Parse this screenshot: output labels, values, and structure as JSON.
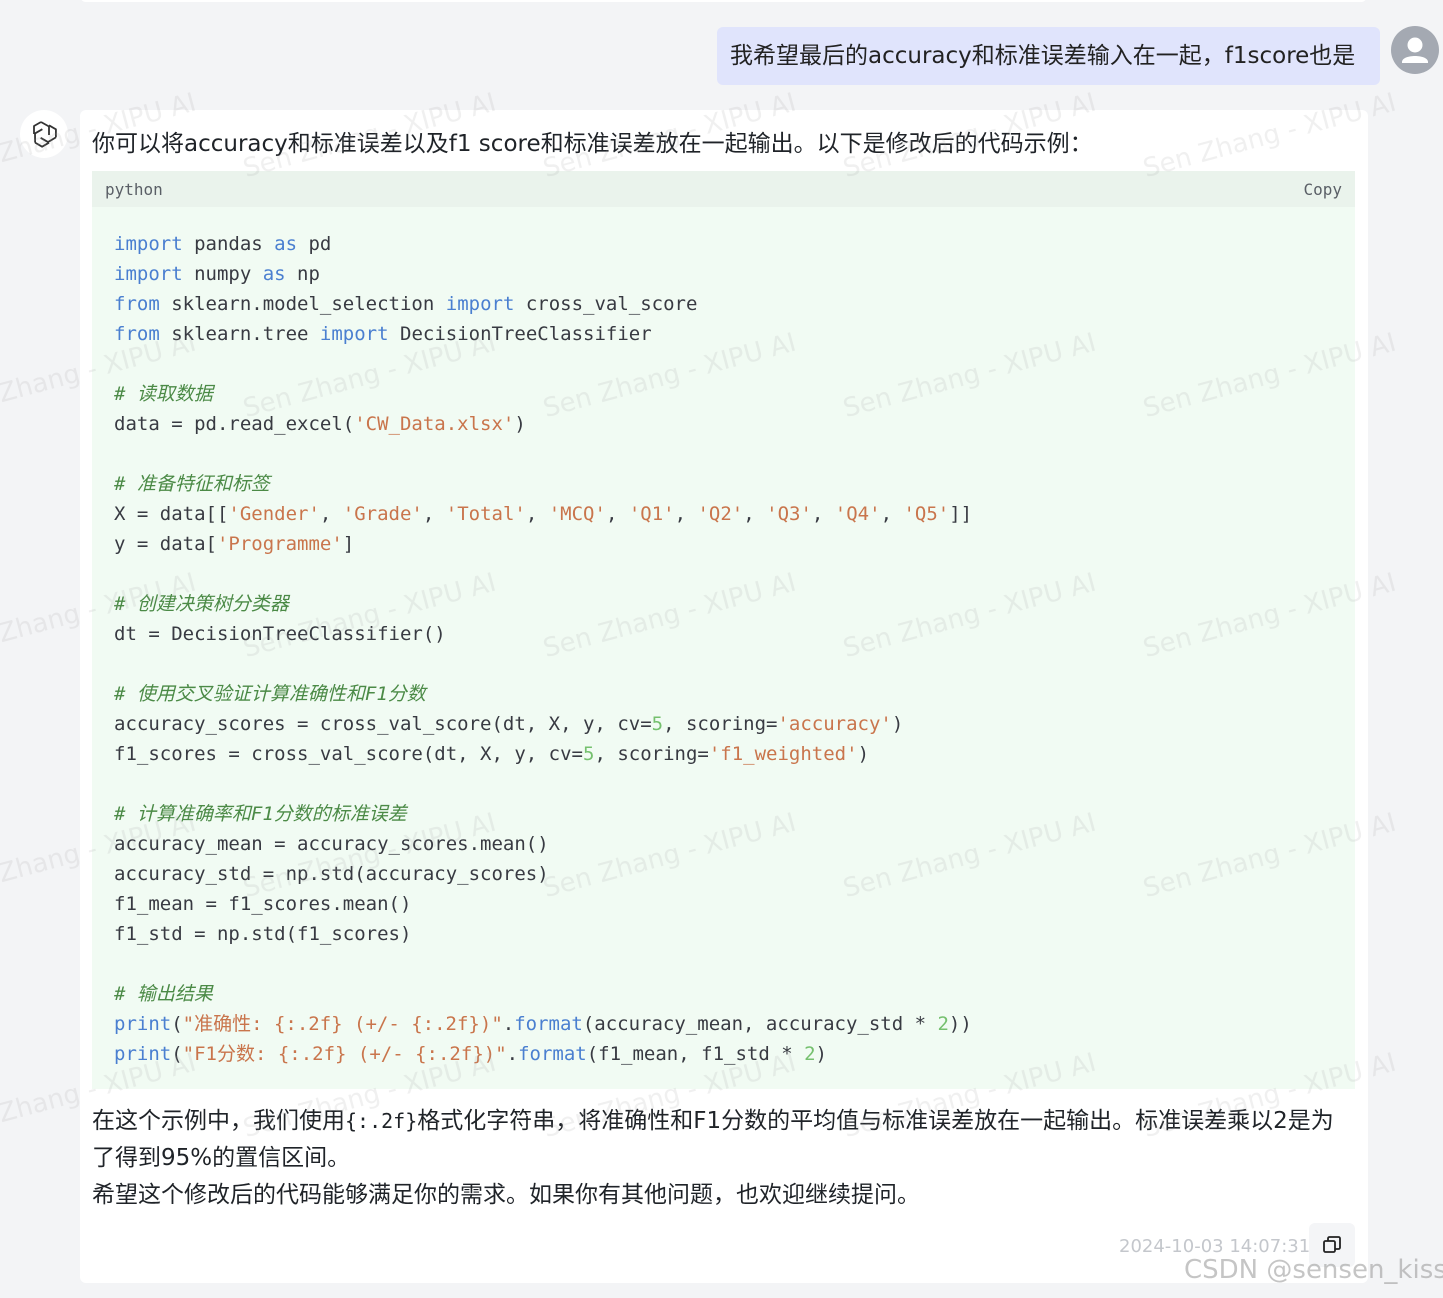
{
  "user_message": {
    "text": "我希望最后的accuracy和标准误差输入在一起，f1score也是",
    "avatar_icon": "user-avatar-icon"
  },
  "assistant_message": {
    "avatar_icon": "openai-logo-icon",
    "intro": "你可以将accuracy和标准误差以及f1 score和标准误差放在一起输出。以下是修改后的代码示例：",
    "code_block": {
      "language": "python",
      "copy_label": "Copy",
      "lines": [
        [
          {
            "t": "import",
            "c": "kw"
          },
          {
            "t": " pandas "
          },
          {
            "t": "as",
            "c": "kw"
          },
          {
            "t": " pd"
          }
        ],
        [
          {
            "t": "import",
            "c": "kw"
          },
          {
            "t": " numpy "
          },
          {
            "t": "as",
            "c": "kw"
          },
          {
            "t": " np"
          }
        ],
        [
          {
            "t": "from",
            "c": "kw"
          },
          {
            "t": " sklearn.model_selection "
          },
          {
            "t": "import",
            "c": "kw"
          },
          {
            "t": " cross_val_score"
          }
        ],
        [
          {
            "t": "from",
            "c": "kw"
          },
          {
            "t": " sklearn.tree "
          },
          {
            "t": "import",
            "c": "kw"
          },
          {
            "t": " DecisionTreeClassifier"
          }
        ],
        [],
        [
          {
            "t": "# 读取数据",
            "c": "cm"
          }
        ],
        [
          {
            "t": "data = pd.read_excel("
          },
          {
            "t": "'CW_Data.xlsx'",
            "c": "str"
          },
          {
            "t": ")"
          }
        ],
        [],
        [
          {
            "t": "# 准备特征和标签",
            "c": "cm"
          }
        ],
        [
          {
            "t": "X = data[["
          },
          {
            "t": "'Gender'",
            "c": "str"
          },
          {
            "t": ", "
          },
          {
            "t": "'Grade'",
            "c": "str"
          },
          {
            "t": ", "
          },
          {
            "t": "'Total'",
            "c": "str"
          },
          {
            "t": ", "
          },
          {
            "t": "'MCQ'",
            "c": "str"
          },
          {
            "t": ", "
          },
          {
            "t": "'Q1'",
            "c": "str"
          },
          {
            "t": ", "
          },
          {
            "t": "'Q2'",
            "c": "str"
          },
          {
            "t": ", "
          },
          {
            "t": "'Q3'",
            "c": "str"
          },
          {
            "t": ", "
          },
          {
            "t": "'Q4'",
            "c": "str"
          },
          {
            "t": ", "
          },
          {
            "t": "'Q5'",
            "c": "str"
          },
          {
            "t": "]]"
          }
        ],
        [
          {
            "t": "y = data["
          },
          {
            "t": "'Programme'",
            "c": "str"
          },
          {
            "t": "]"
          }
        ],
        [],
        [
          {
            "t": "# 创建决策树分类器",
            "c": "cm"
          }
        ],
        [
          {
            "t": "dt = DecisionTreeClassifier()"
          }
        ],
        [],
        [
          {
            "t": "# 使用交叉验证计算准确性和F1分数",
            "c": "cm"
          }
        ],
        [
          {
            "t": "accuracy_scores = cross_val_score(dt, X, y, cv="
          },
          {
            "t": "5",
            "c": "num"
          },
          {
            "t": ", scoring="
          },
          {
            "t": "'accuracy'",
            "c": "str"
          },
          {
            "t": ")"
          }
        ],
        [
          {
            "t": "f1_scores = cross_val_score(dt, X, y, cv="
          },
          {
            "t": "5",
            "c": "num"
          },
          {
            "t": ", scoring="
          },
          {
            "t": "'f1_weighted'",
            "c": "str"
          },
          {
            "t": ")"
          }
        ],
        [],
        [
          {
            "t": "# 计算准确率和F1分数的标准误差",
            "c": "cm"
          }
        ],
        [
          {
            "t": "accuracy_mean = accuracy_scores.mean()"
          }
        ],
        [
          {
            "t": "accuracy_std = np.std(accuracy_scores)"
          }
        ],
        [
          {
            "t": "f1_mean = f1_scores.mean()"
          }
        ],
        [
          {
            "t": "f1_std = np.std(f1_scores)"
          }
        ],
        [],
        [
          {
            "t": "# 输出结果",
            "c": "cm"
          }
        ],
        [
          {
            "t": "print",
            "c": "fn"
          },
          {
            "t": "("
          },
          {
            "t": "\"准确性: {:.2f} (+/- {:.2f})\"",
            "c": "str"
          },
          {
            "t": "."
          },
          {
            "t": "format",
            "c": "fn"
          },
          {
            "t": "(accuracy_mean, accuracy_std * "
          },
          {
            "t": "2",
            "c": "num"
          },
          {
            "t": "))"
          }
        ],
        [
          {
            "t": "print",
            "c": "fn"
          },
          {
            "t": "("
          },
          {
            "t": "\"F1分数: {:.2f} (+/- {:.2f})\"",
            "c": "str"
          },
          {
            "t": "."
          },
          {
            "t": "format",
            "c": "fn"
          },
          {
            "t": "(f1_mean, f1_std * "
          },
          {
            "t": "2",
            "c": "num"
          },
          {
            "t": ")"
          }
        ]
      ]
    },
    "outro_part1": "在这个示例中，我们使用",
    "outro_code": "{:.2f}",
    "outro_part2": "格式化字符串，将准确性和F1分数的平均值与标准误差放在一起输出。标准误差乘以2是为了得到95%的置信区间。",
    "outro_line2": "希望这个修改后的代码能够满足你的需求。如果你有其他问题，也欢迎继续提问。",
    "timestamp": "2024-10-03 14:07:31",
    "copy_icon": "copy-icon"
  },
  "watermark": {
    "text": "Sen Zhang - XIPU AI",
    "csdn": "CSDN @sensen_kiss"
  },
  "colors": {
    "page_bg": "#f3f4f6",
    "user_bubble": "#e0e4fc",
    "code_bg": "#f1fbf3",
    "code_header_bg": "#eaf3ec",
    "keyword": "#4a7fd0",
    "string": "#c9754c",
    "number": "#75c06e",
    "comment": "#4b8a46"
  }
}
